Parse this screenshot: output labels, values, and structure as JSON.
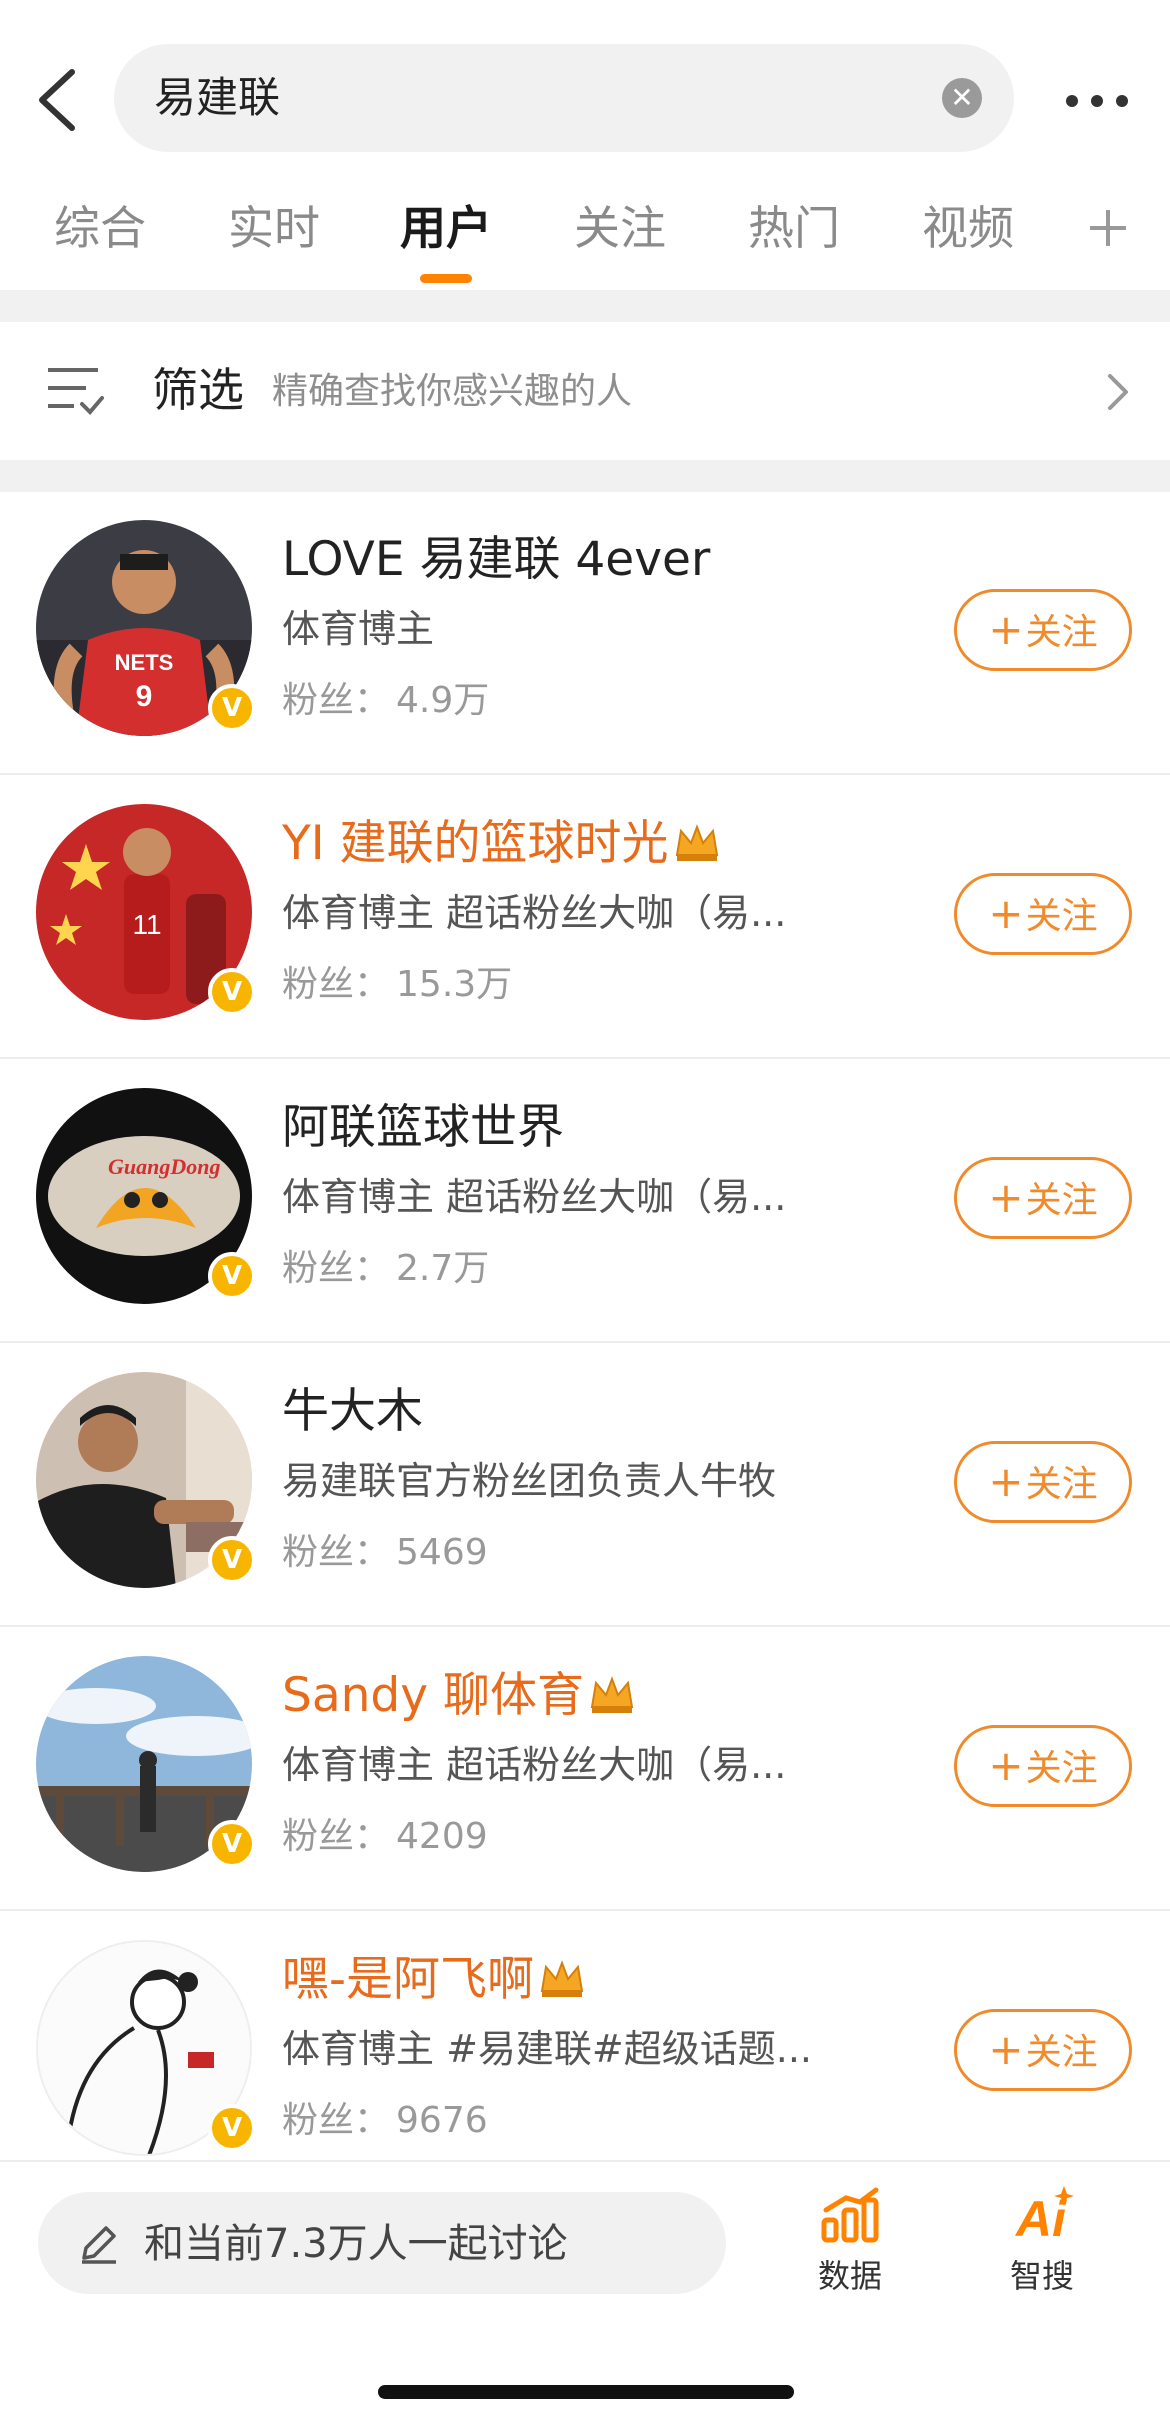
{
  "search": {
    "query": "易建联",
    "clear_icon": "clear-circle-icon",
    "back_icon": "chevron-left-icon",
    "more_icon": "more-dots-icon"
  },
  "tabs": [
    {
      "label": "综合",
      "active": false
    },
    {
      "label": "实时",
      "active": false
    },
    {
      "label": "用户",
      "active": true
    },
    {
      "label": "关注",
      "active": false
    },
    {
      "label": "热门",
      "active": false
    },
    {
      "label": "视频",
      "active": false
    }
  ],
  "filter": {
    "title": "筛选",
    "description": "精确查找你感兴趣的人",
    "icon": "filter-list-icon"
  },
  "users": [
    {
      "name": "LOVE 易建联 4ever",
      "vip": false,
      "description": "体育博主",
      "fans_label": "粉丝：",
      "fans_count": "4.9万",
      "follow_label": "关注",
      "verified": "V"
    },
    {
      "name": "YI 建联的篮球时光",
      "vip": true,
      "description": "体育博主 超话粉丝大咖（易...",
      "fans_label": "粉丝：",
      "fans_count": "15.3万",
      "follow_label": "关注",
      "verified": "V"
    },
    {
      "name": "阿联篮球世界",
      "vip": false,
      "description": "体育博主 超话粉丝大咖（易...",
      "fans_label": "粉丝：",
      "fans_count": "2.7万",
      "follow_label": "关注",
      "verified": "V"
    },
    {
      "name": "牛大木",
      "vip": false,
      "description": "易建联官方粉丝团负责人牛牧",
      "fans_label": "粉丝：",
      "fans_count": "5469",
      "follow_label": "关注",
      "verified": "V"
    },
    {
      "name": "Sandy 聊体育",
      "vip": true,
      "description": "体育博主 超话粉丝大咖（易...",
      "fans_label": "粉丝：",
      "fans_count": "4209",
      "follow_label": "关注",
      "verified": "V"
    },
    {
      "name": "嘿-是阿飞啊",
      "vip": true,
      "description": "体育博主 #易建联#超级话题...",
      "fans_label": "粉丝：",
      "fans_count": "9676",
      "follow_label": "关注",
      "verified": "V"
    }
  ],
  "bottom": {
    "compose_text": "和当前7.3万人一起讨论",
    "data_label": "数据",
    "smart_search_label": "智搜",
    "smart_search_icon_text": "Ai"
  },
  "colors": {
    "accent": "#ff8200",
    "vip_name": "#e86a1b",
    "follow": "#f08a2a",
    "verified": "#f7b500"
  }
}
